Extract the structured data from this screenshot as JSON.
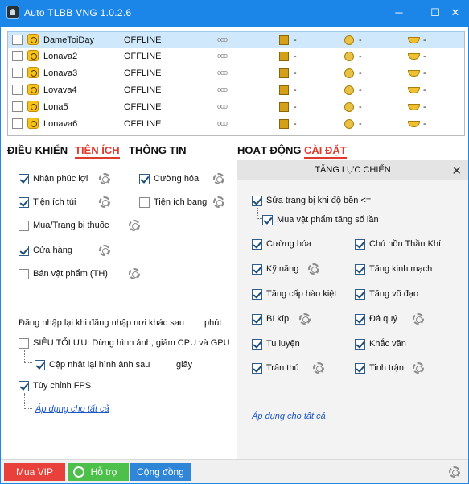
{
  "window": {
    "title": "Auto TLBB VNG 1.0.2.6",
    "controls": {
      "minimize": "─",
      "maximize": "☐",
      "close": "✕"
    }
  },
  "accounts": [
    {
      "name": "DameToiDay",
      "status": "OFFLINE",
      "dots": "ooo",
      "gold_bar": "-",
      "coin": "-",
      "ingot": "-",
      "selected": true
    },
    {
      "name": "Lonava2",
      "status": "OFFLINE",
      "dots": "ooo",
      "gold_bar": "-",
      "coin": "-",
      "ingot": "-"
    },
    {
      "name": "Lonava3",
      "status": "OFFLINE",
      "dots": "ooo",
      "gold_bar": "-",
      "coin": "-",
      "ingot": "-"
    },
    {
      "name": "Lovava4",
      "status": "OFFLINE",
      "dots": "ooo",
      "gold_bar": "-",
      "coin": "-",
      "ingot": "-"
    },
    {
      "name": "Lona5",
      "status": "OFFLINE",
      "dots": "ooo",
      "gold_bar": "-",
      "coin": "-",
      "ingot": "-"
    },
    {
      "name": "Lonava6",
      "status": "OFFLINE",
      "dots": "ooo",
      "gold_bar": "-",
      "coin": "-",
      "ingot": "-"
    }
  ],
  "left_tabs": {
    "control": "ĐIỀU KHIỂN",
    "utilities": "TIỆN ÍCH",
    "info": "THÔNG TIN",
    "active": "utilities"
  },
  "right_tabs": {
    "activity": "HOẠT ĐỘNG",
    "settings": "CÀI ĐẶT",
    "active": "settings"
  },
  "utilities": {
    "items": {
      "nhan_phuc_loi": {
        "label": "Nhận phúc lợi",
        "checked": true
      },
      "cuong_hoa": {
        "label": "Cường hóa",
        "checked": true
      },
      "tien_ich_tui": {
        "label": "Tiện ích túi",
        "checked": true
      },
      "tien_ich_bang": {
        "label": "Tiện ích bang",
        "checked": false
      },
      "mua_trang_bi_thuoc": {
        "label": "Mua/Trang bị thuốc",
        "checked": false
      },
      "cua_hang": {
        "label": "Cửa hàng",
        "checked": true
      },
      "ban_vat_pham": {
        "label": "Bán vật phẩm (TH)",
        "checked": false
      }
    },
    "relogin_text": "Đăng nhập lại khi đăng nhập nơi khác sau",
    "relogin_unit": "phút",
    "super_opt": {
      "label": "SIÊU TỐI ƯU: Dừng hình ảnh, giảm CPU và GPU",
      "checked": false
    },
    "refresh_image": {
      "label": "Cập nhật lại hình ảnh sau",
      "unit": "giây",
      "checked": true
    },
    "custom_fps": {
      "label": "Tùy chỉnh FPS",
      "checked": true
    },
    "apply_all": "Áp dụng cho tất cả"
  },
  "settings_panel": {
    "title": "TĂNG LỰC CHIẾN",
    "close": "✕",
    "items": {
      "sua_trang_bi": {
        "label": "Sửa trang bị khi độ bền <=",
        "checked": true
      },
      "mua_vat_pham": {
        "label": "Mua vật phẩm tăng số lần",
        "checked": true
      },
      "cuong_hoa": {
        "label": "Cường hóa",
        "checked": true
      },
      "chu_hon": {
        "label": "Chú hồn Thần Khí",
        "checked": true
      },
      "ky_nang": {
        "label": "Kỹ năng",
        "checked": true
      },
      "tang_kinh_mach": {
        "label": "Tăng kinh mạch",
        "checked": true
      },
      "tang_cap_hao_kiet": {
        "label": "Tăng cấp hào kiệt",
        "checked": true
      },
      "tang_vo_dao": {
        "label": "Tăng võ đạo",
        "checked": true
      },
      "bi_kip": {
        "label": "Bí kíp",
        "checked": true
      },
      "da_quy": {
        "label": "Đá quý",
        "checked": true
      },
      "tu_luyen": {
        "label": "Tu luyện",
        "checked": true
      },
      "khac_van": {
        "label": "Khắc văn",
        "checked": true
      },
      "tran_thu": {
        "label": "Trân thú",
        "checked": true
      },
      "tinh_tran": {
        "label": "Tinh trận",
        "checked": true
      }
    },
    "apply_all": "Áp dụng cho tất cả"
  },
  "footer": {
    "buy_vip": "Mua VIP",
    "support": "Hỗ trợ",
    "community": "Cộng đồng"
  },
  "colors": {
    "titlebar": "#1c86e8",
    "tab_active": "#e03a2e",
    "buy_vip": "#e8413b",
    "support": "#4cc04a",
    "community": "#2f86d6"
  }
}
